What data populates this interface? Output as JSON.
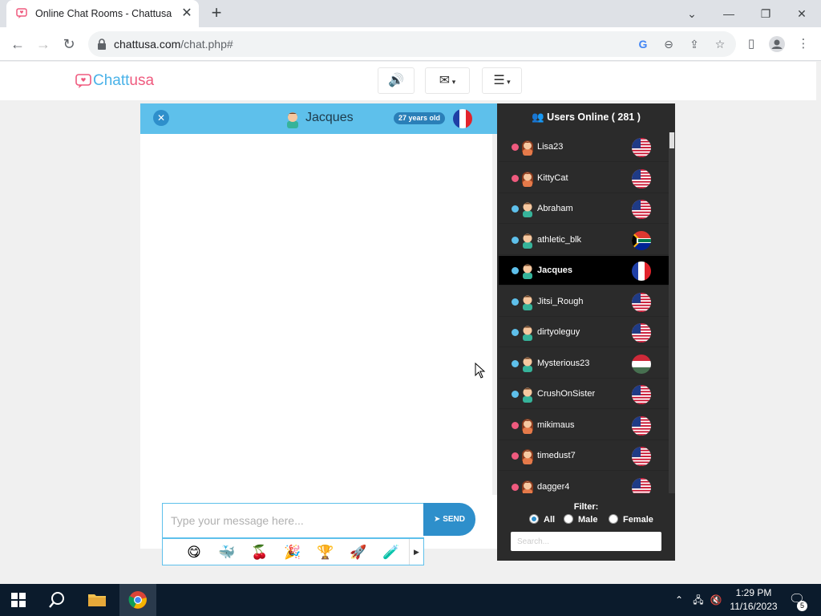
{
  "browser": {
    "tab_title": "Online Chat Rooms - Chattusa",
    "url_host": "chattusa.com",
    "url_path": "/chat.php#"
  },
  "site": {
    "logo_part1": "Chatt",
    "logo_part2": "usa"
  },
  "chat": {
    "partner_name": "Jacques",
    "partner_age": "27 years old",
    "partner_flag": "france",
    "input_placeholder": "Type your message here...",
    "send_label": "SEND",
    "emojis": [
      "😋",
      "🐳",
      "🍒",
      "🎉",
      "🏆",
      "🚀",
      "🧪"
    ]
  },
  "users_panel": {
    "title": "Users Online ( 281 )",
    "filter_label": "Filter:",
    "filter_options": [
      "All",
      "Male",
      "Female"
    ],
    "filter_selected": "All",
    "search_placeholder": "Search...",
    "users": [
      {
        "name": "Lisa23",
        "gender": "female",
        "flag": "usa"
      },
      {
        "name": "KittyCat",
        "gender": "female",
        "flag": "usa"
      },
      {
        "name": "Abraham",
        "gender": "male",
        "flag": "usa"
      },
      {
        "name": "athletic_blk",
        "gender": "male",
        "flag": "south-africa"
      },
      {
        "name": "Jacques",
        "gender": "male",
        "flag": "france",
        "active": true
      },
      {
        "name": "Jitsi_Rough",
        "gender": "male",
        "flag": "usa"
      },
      {
        "name": "dirtyoleguy",
        "gender": "male",
        "flag": "usa"
      },
      {
        "name": "Mysterious23",
        "gender": "male",
        "flag": "hungary"
      },
      {
        "name": "CrushOnSister",
        "gender": "male",
        "flag": "usa"
      },
      {
        "name": "mikimaus",
        "gender": "female",
        "flag": "usa"
      },
      {
        "name": "timedust7",
        "gender": "female",
        "flag": "usa"
      },
      {
        "name": "dagger4",
        "gender": "female",
        "flag": "usa"
      }
    ]
  },
  "taskbar": {
    "time": "1:29 PM",
    "date": "11/16/2023",
    "notifications": "5"
  },
  "colors": {
    "accent": "#5ec0eb",
    "accent_dark": "#2e8fcb",
    "male_dot": "#5ec0eb",
    "female_dot": "#ef5a7e",
    "panel_dark": "#2b2b2b"
  }
}
